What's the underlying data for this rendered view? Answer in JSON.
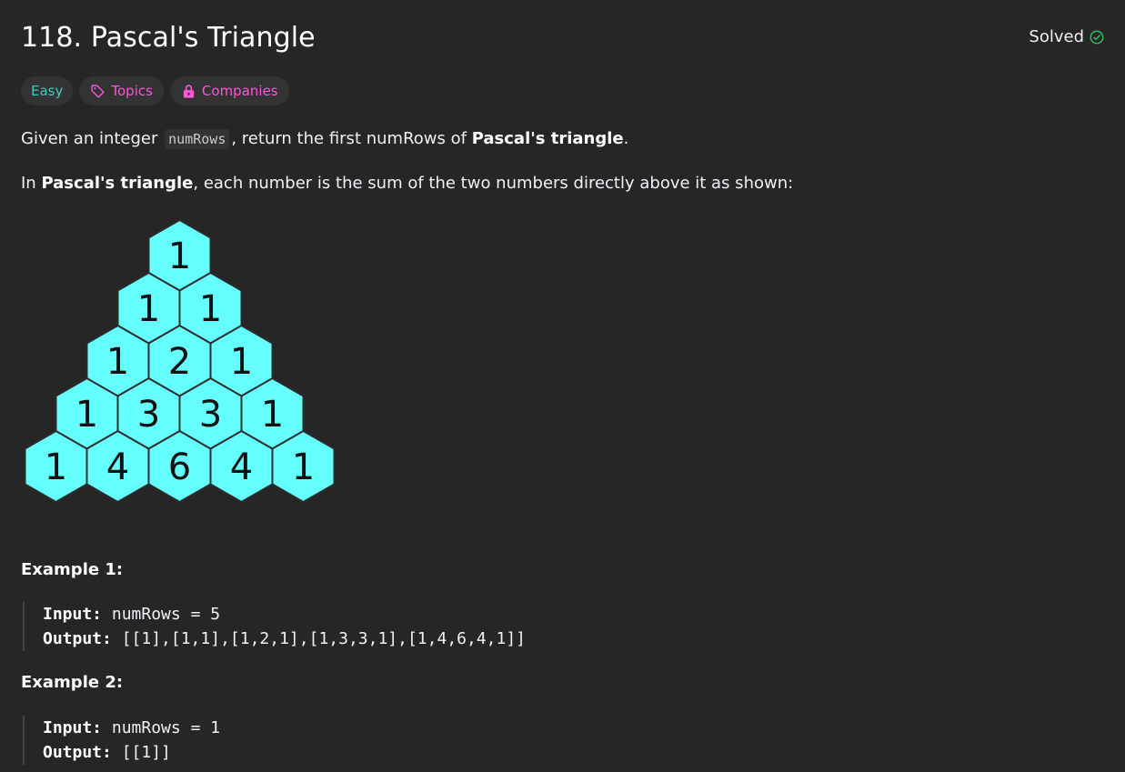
{
  "problem": {
    "title": "118. Pascal's Triangle",
    "status": "Solved"
  },
  "tags": {
    "difficulty": "Easy",
    "topics": "Topics",
    "companies": "Companies"
  },
  "description": {
    "p1_prefix": "Given an integer ",
    "p1_code": "numRows",
    "p1_middle": ", return the first numRows of ",
    "p1_bold": "Pascal's triangle",
    "p1_suffix": ".",
    "p2_prefix": "In ",
    "p2_bold": "Pascal's triangle",
    "p2_suffix": ", each number is the sum of the two numbers directly above it as shown:"
  },
  "triangle": {
    "rows": [
      [
        "1"
      ],
      [
        "1",
        "1"
      ],
      [
        "1",
        "2",
        "1"
      ],
      [
        "1",
        "3",
        "3",
        "1"
      ],
      [
        "1",
        "4",
        "6",
        "4",
        "1"
      ]
    ],
    "fill": "#66ffff",
    "stroke": "#2b2b2b"
  },
  "examples": [
    {
      "title": "Example 1:",
      "input_label": "Input:",
      "input_value": "numRows = 5",
      "output_label": "Output:",
      "output_value": "[[1],[1,1],[1,2,1],[1,3,3,1],[1,4,6,4,1]]"
    },
    {
      "title": "Example 2:",
      "input_label": "Input:",
      "input_value": "numRows = 1",
      "output_label": "Output:",
      "output_value": "[[1]]"
    }
  ],
  "colors": {
    "background": "#262626",
    "easy": "#46c6c2",
    "tag_accent": "#f758d8",
    "solved_check": "#2cbb5d"
  },
  "icons": {
    "solved": "check-circle-icon",
    "topics": "tag-icon",
    "companies": "lock-icon"
  }
}
